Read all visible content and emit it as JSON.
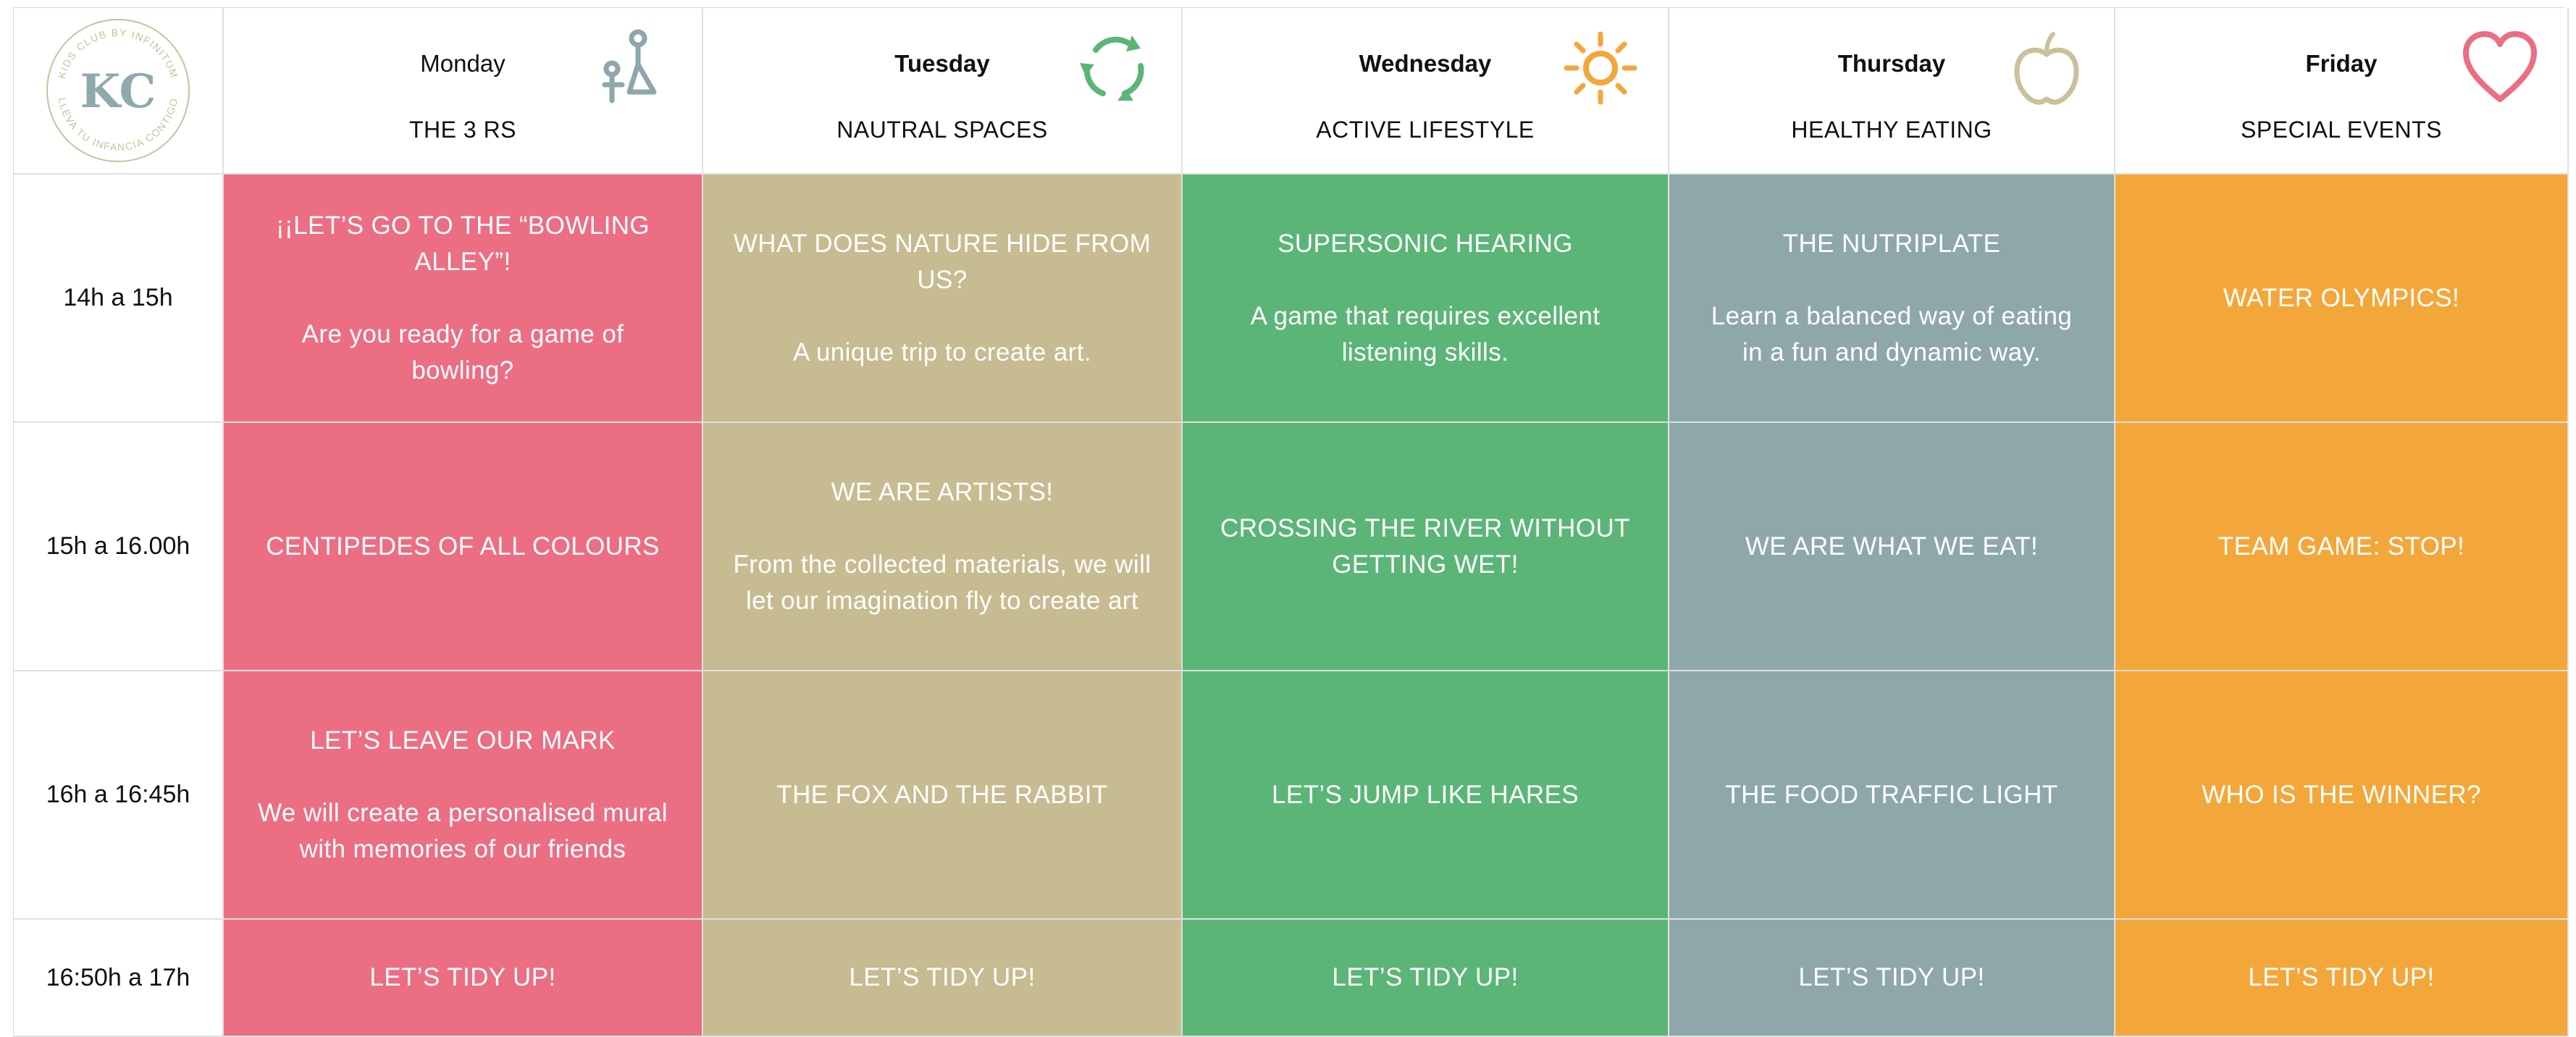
{
  "logo": {
    "monogram": "KC",
    "ring_text_top": "KIDS CLUB BY INFINITUM",
    "ring_text_bottom": "LLEVA TU INFANCIA CONTIGO",
    "color": "#c9c09c",
    "monogram_color": "#8fa9ad"
  },
  "days": [
    {
      "name": "Monday",
      "theme": "THE 3 RS",
      "icon": "recycle-people-icon",
      "color": "#ec6e83"
    },
    {
      "name": "Tuesday",
      "theme": "NAUTRAL SPACES",
      "icon": "recycle-arrows-icon",
      "color": "#c6bb91"
    },
    {
      "name": "Wednesday",
      "theme": "ACTIVE LIFESTYLE",
      "icon": "sun-icon",
      "color": "#5bb577"
    },
    {
      "name": "Thursday",
      "theme": "HEALTHY EATING",
      "icon": "apple-icon",
      "color": "#8ea7ab"
    },
    {
      "name": "Friday",
      "theme": "SPECIAL EVENTS",
      "icon": "heart-icon",
      "color": "#f3a73a"
    }
  ],
  "times": [
    "14h a 15h",
    "15h a 16.00h",
    "16h a 16:45h",
    "16:50h a 17h"
  ],
  "activities": [
    [
      {
        "title": "¡¡LET’S GO TO THE “BOWLING ALLEY”!",
        "desc": "Are you ready for a game of bowling?"
      },
      {
        "title": "WHAT DOES NATURE HIDE FROM US?",
        "desc": "A unique trip to create art."
      },
      {
        "title": "SUPERSONIC HEARING",
        "desc": "A game that requires excellent listening skills."
      },
      {
        "title": "THE NUTRIPLATE",
        "desc": "Learn a balanced way of eating in a fun and dynamic way."
      },
      {
        "title": "WATER OLYMPICS!",
        "desc": ""
      }
    ],
    [
      {
        "title": "CENTIPEDES OF ALL COLOURS",
        "desc": ""
      },
      {
        "title": "WE ARE ARTISTS!",
        "desc": "From the collected materials, we will let our imagination fly to create art"
      },
      {
        "title": "CROSSING THE RIVER WITHOUT GETTING WET!",
        "desc": ""
      },
      {
        "title": "WE ARE WHAT WE EAT!",
        "desc": ""
      },
      {
        "title": "TEAM GAME: STOP!",
        "desc": ""
      }
    ],
    [
      {
        "title": "LET’S LEAVE OUR MARK",
        "desc": "We will create a personalised mural with memories of our friends"
      },
      {
        "title": "THE FOX AND THE RABBIT",
        "desc": ""
      },
      {
        "title": "LET’S JUMP LIKE HARES",
        "desc": ""
      },
      {
        "title": "THE FOOD TRAFFIC LIGHT",
        "desc": ""
      },
      {
        "title": "WHO IS THE WINNER?",
        "desc": ""
      }
    ],
    [
      {
        "title": "LET’S TIDY UP!",
        "desc": ""
      },
      {
        "title": "LET’S TIDY UP!",
        "desc": ""
      },
      {
        "title": "LET’S TIDY UP!",
        "desc": ""
      },
      {
        "title": "LET’S TIDY UP!",
        "desc": ""
      },
      {
        "title": "LET’S TIDY UP!",
        "desc": ""
      }
    ]
  ]
}
